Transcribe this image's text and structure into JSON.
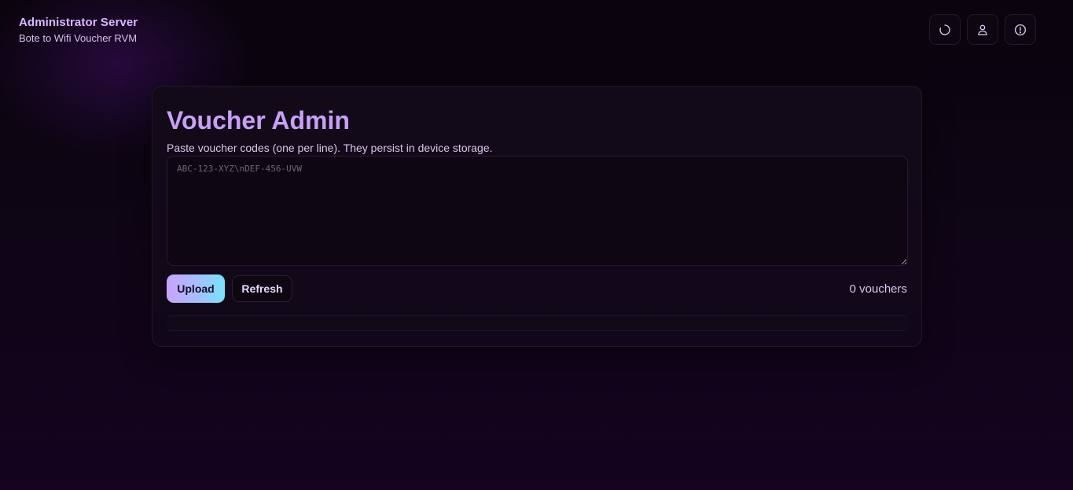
{
  "header": {
    "title": "Administrator Server",
    "subtitle": "Bote to Wifi Voucher RVM",
    "actions": [
      {
        "icon": "refresh-icon"
      },
      {
        "icon": "user-icon"
      },
      {
        "icon": "alert-circle-icon"
      }
    ]
  },
  "card": {
    "title": "Voucher Admin",
    "description": "Paste voucher codes (one per line). They persist in device storage.",
    "codes_input": {
      "value": "",
      "placeholder": "ABC-123-XYZ\\nDEF-456-UVW"
    },
    "upload_label": "Upload",
    "refresh_label": "Refresh",
    "voucher_count": "0 vouchers",
    "vouchers": []
  },
  "colors": {
    "accent": "#c9a0f7",
    "gradient_start": "#caa2ff",
    "gradient_end": "#79e2ff",
    "background": "#0e0515"
  }
}
